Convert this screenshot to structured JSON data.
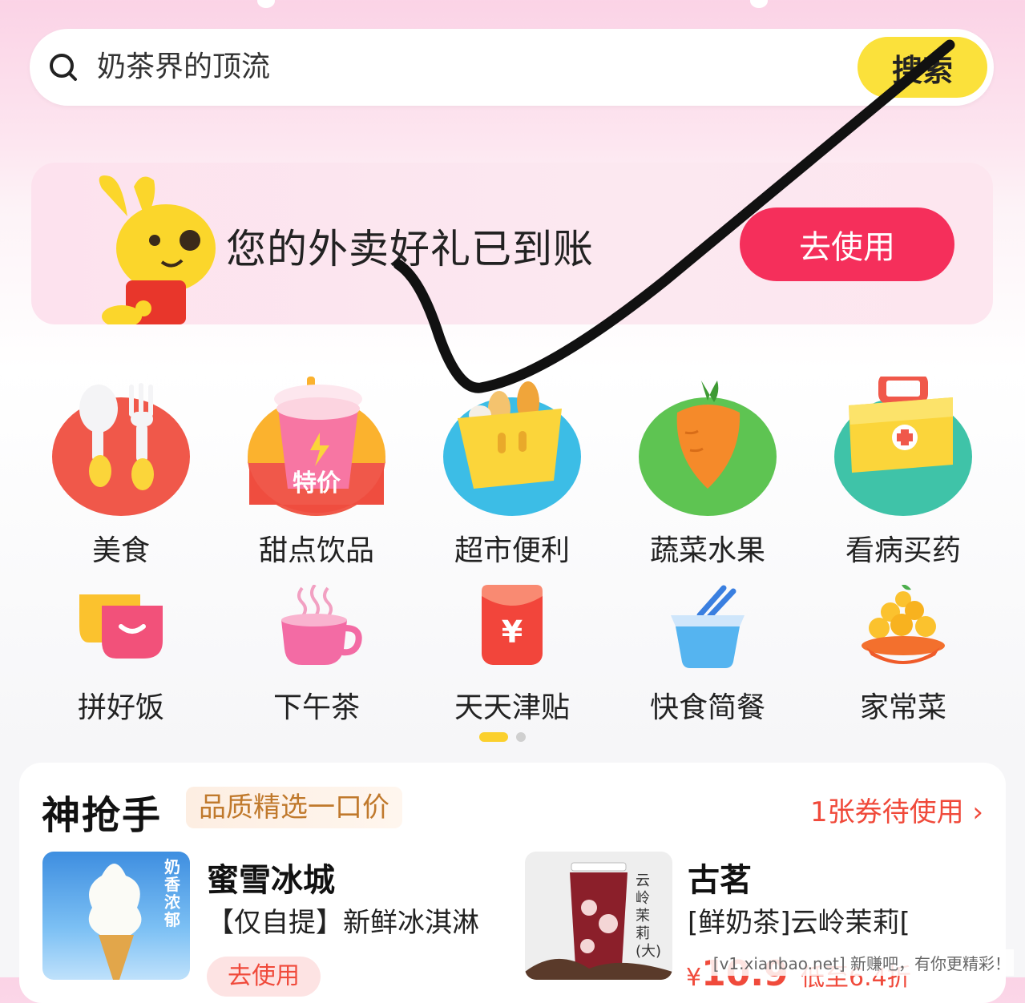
{
  "search": {
    "placeholder": "奶茶界的顶流",
    "button_label": "搜索"
  },
  "banner": {
    "text": "您的外卖好礼已到账",
    "button_label": "去使用"
  },
  "categories_row1": [
    {
      "label": "美食",
      "icon": "spoon-fork-icon"
    },
    {
      "label": "甜点饮品",
      "icon": "drink-cup-icon",
      "badge": "特价"
    },
    {
      "label": "超市便利",
      "icon": "shopping-basket-icon"
    },
    {
      "label": "蔬菜水果",
      "icon": "carrot-icon"
    },
    {
      "label": "看病买药",
      "icon": "medicine-box-icon"
    }
  ],
  "categories_row2": [
    {
      "label": "拼好饭",
      "icon": "bowl-smile-icon"
    },
    {
      "label": "下午茶",
      "icon": "tea-cup-icon"
    },
    {
      "label": "天天津贴",
      "icon": "red-packet-icon"
    },
    {
      "label": "快食简餐",
      "icon": "takeout-box-icon"
    },
    {
      "label": "家常菜",
      "icon": "dish-icon"
    }
  ],
  "deals": {
    "title": "神抢手",
    "tag": "品质精选一口价",
    "coupon_text": "1张券待使用",
    "items": [
      {
        "shop": "蜜雪冰城",
        "desc": "【仅自提】新鲜冰淇淋",
        "image_text": "奶香浓郁",
        "button": "去使用"
      },
      {
        "shop": "古茗",
        "desc": "[鲜奶茶]云岭茉莉[",
        "image_text": "云岭茉莉(大)",
        "price_prefix": "¥",
        "price": "10.9",
        "discount": "低至6.4折"
      }
    ]
  },
  "watermark": "[v1.xianbao.net] 新赚吧，有你更精彩！",
  "colors": {
    "accent_yellow": "#fbe13b",
    "accent_red": "#f52f5b",
    "coupon_red": "#f0493a"
  }
}
